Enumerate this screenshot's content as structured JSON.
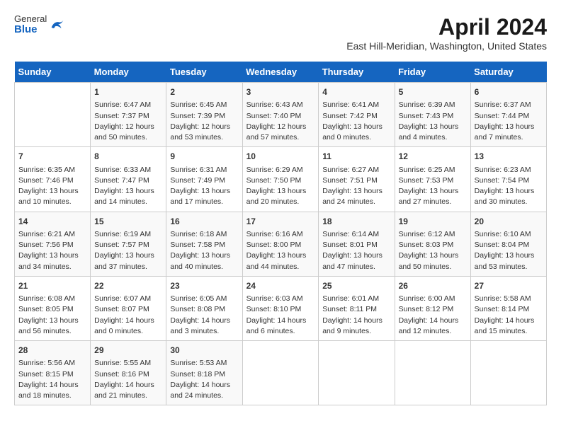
{
  "header": {
    "logo_general": "General",
    "logo_blue": "Blue",
    "title": "April 2024",
    "subtitle": "East Hill-Meridian, Washington, United States"
  },
  "calendar": {
    "days_of_week": [
      "Sunday",
      "Monday",
      "Tuesday",
      "Wednesday",
      "Thursday",
      "Friday",
      "Saturday"
    ],
    "weeks": [
      [
        {
          "day": "",
          "content": ""
        },
        {
          "day": "1",
          "content": "Sunrise: 6:47 AM\nSunset: 7:37 PM\nDaylight: 12 hours\nand 50 minutes."
        },
        {
          "day": "2",
          "content": "Sunrise: 6:45 AM\nSunset: 7:39 PM\nDaylight: 12 hours\nand 53 minutes."
        },
        {
          "day": "3",
          "content": "Sunrise: 6:43 AM\nSunset: 7:40 PM\nDaylight: 12 hours\nand 57 minutes."
        },
        {
          "day": "4",
          "content": "Sunrise: 6:41 AM\nSunset: 7:42 PM\nDaylight: 13 hours\nand 0 minutes."
        },
        {
          "day": "5",
          "content": "Sunrise: 6:39 AM\nSunset: 7:43 PM\nDaylight: 13 hours\nand 4 minutes."
        },
        {
          "day": "6",
          "content": "Sunrise: 6:37 AM\nSunset: 7:44 PM\nDaylight: 13 hours\nand 7 minutes."
        }
      ],
      [
        {
          "day": "7",
          "content": "Sunrise: 6:35 AM\nSunset: 7:46 PM\nDaylight: 13 hours\nand 10 minutes."
        },
        {
          "day": "8",
          "content": "Sunrise: 6:33 AM\nSunset: 7:47 PM\nDaylight: 13 hours\nand 14 minutes."
        },
        {
          "day": "9",
          "content": "Sunrise: 6:31 AM\nSunset: 7:49 PM\nDaylight: 13 hours\nand 17 minutes."
        },
        {
          "day": "10",
          "content": "Sunrise: 6:29 AM\nSunset: 7:50 PM\nDaylight: 13 hours\nand 20 minutes."
        },
        {
          "day": "11",
          "content": "Sunrise: 6:27 AM\nSunset: 7:51 PM\nDaylight: 13 hours\nand 24 minutes."
        },
        {
          "day": "12",
          "content": "Sunrise: 6:25 AM\nSunset: 7:53 PM\nDaylight: 13 hours\nand 27 minutes."
        },
        {
          "day": "13",
          "content": "Sunrise: 6:23 AM\nSunset: 7:54 PM\nDaylight: 13 hours\nand 30 minutes."
        }
      ],
      [
        {
          "day": "14",
          "content": "Sunrise: 6:21 AM\nSunset: 7:56 PM\nDaylight: 13 hours\nand 34 minutes."
        },
        {
          "day": "15",
          "content": "Sunrise: 6:19 AM\nSunset: 7:57 PM\nDaylight: 13 hours\nand 37 minutes."
        },
        {
          "day": "16",
          "content": "Sunrise: 6:18 AM\nSunset: 7:58 PM\nDaylight: 13 hours\nand 40 minutes."
        },
        {
          "day": "17",
          "content": "Sunrise: 6:16 AM\nSunset: 8:00 PM\nDaylight: 13 hours\nand 44 minutes."
        },
        {
          "day": "18",
          "content": "Sunrise: 6:14 AM\nSunset: 8:01 PM\nDaylight: 13 hours\nand 47 minutes."
        },
        {
          "day": "19",
          "content": "Sunrise: 6:12 AM\nSunset: 8:03 PM\nDaylight: 13 hours\nand 50 minutes."
        },
        {
          "day": "20",
          "content": "Sunrise: 6:10 AM\nSunset: 8:04 PM\nDaylight: 13 hours\nand 53 minutes."
        }
      ],
      [
        {
          "day": "21",
          "content": "Sunrise: 6:08 AM\nSunset: 8:05 PM\nDaylight: 13 hours\nand 56 minutes."
        },
        {
          "day": "22",
          "content": "Sunrise: 6:07 AM\nSunset: 8:07 PM\nDaylight: 14 hours\nand 0 minutes."
        },
        {
          "day": "23",
          "content": "Sunrise: 6:05 AM\nSunset: 8:08 PM\nDaylight: 14 hours\nand 3 minutes."
        },
        {
          "day": "24",
          "content": "Sunrise: 6:03 AM\nSunset: 8:10 PM\nDaylight: 14 hours\nand 6 minutes."
        },
        {
          "day": "25",
          "content": "Sunrise: 6:01 AM\nSunset: 8:11 PM\nDaylight: 14 hours\nand 9 minutes."
        },
        {
          "day": "26",
          "content": "Sunrise: 6:00 AM\nSunset: 8:12 PM\nDaylight: 14 hours\nand 12 minutes."
        },
        {
          "day": "27",
          "content": "Sunrise: 5:58 AM\nSunset: 8:14 PM\nDaylight: 14 hours\nand 15 minutes."
        }
      ],
      [
        {
          "day": "28",
          "content": "Sunrise: 5:56 AM\nSunset: 8:15 PM\nDaylight: 14 hours\nand 18 minutes."
        },
        {
          "day": "29",
          "content": "Sunrise: 5:55 AM\nSunset: 8:16 PM\nDaylight: 14 hours\nand 21 minutes."
        },
        {
          "day": "30",
          "content": "Sunrise: 5:53 AM\nSunset: 8:18 PM\nDaylight: 14 hours\nand 24 minutes."
        },
        {
          "day": "",
          "content": ""
        },
        {
          "day": "",
          "content": ""
        },
        {
          "day": "",
          "content": ""
        },
        {
          "day": "",
          "content": ""
        }
      ]
    ]
  }
}
